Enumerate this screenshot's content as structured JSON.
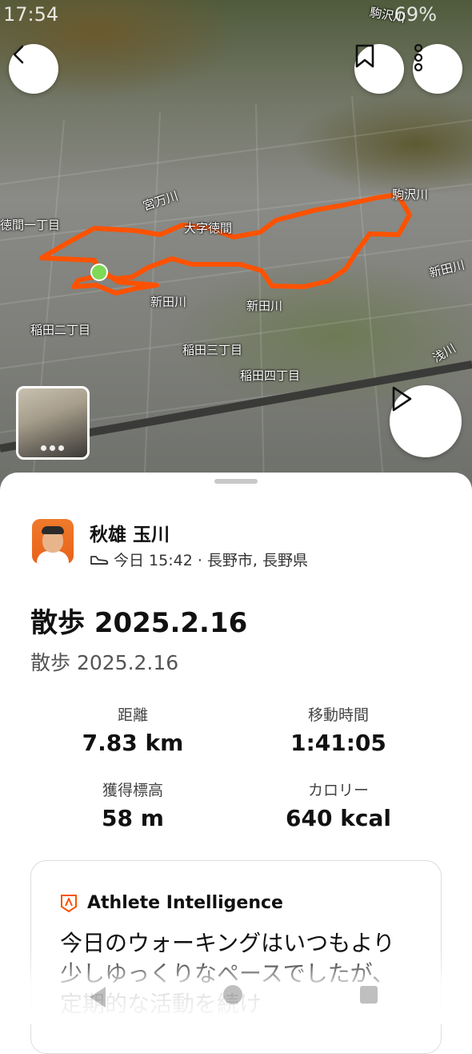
{
  "status_bar": {
    "time": "17:54",
    "battery": "69%"
  },
  "map": {
    "labels": {
      "tokuma_1": "徳間一丁目",
      "ohaza_tokuma": "大字徳間",
      "kamagawa": "宮万川",
      "komazawa": "駒沢川",
      "shinden_1": "新田川",
      "shinden_2": "新田川",
      "shinden_3": "新田川",
      "inada_2": "稲田二丁目",
      "inada_3": "稲田三丁目",
      "inada_4": "稲田四丁目",
      "asakawa": "浅川",
      "top_right": "駒沢川"
    }
  },
  "activity": {
    "user_name": "秋雄 玉川",
    "meta": "今日 15:42 · 長野市, 長野県",
    "title": "散歩 2025.2.16",
    "subtitle": "散歩 2025.2.16",
    "stats": [
      {
        "label": "距離",
        "value": "7.83 km"
      },
      {
        "label": "移動時間",
        "value": "1:41:05"
      },
      {
        "label": "獲得標高",
        "value": "58 m"
      },
      {
        "label": "カロリー",
        "value": "640 kcal"
      }
    ],
    "ai": {
      "heading": "Athlete Intelligence",
      "text": "今日のウォーキングはいつもより少しゆっくりなペースでしたが、定期的な活動を続け"
    }
  },
  "colors": {
    "route": "#fc5200",
    "start": "#7ed957",
    "accent": "#fc5200"
  }
}
